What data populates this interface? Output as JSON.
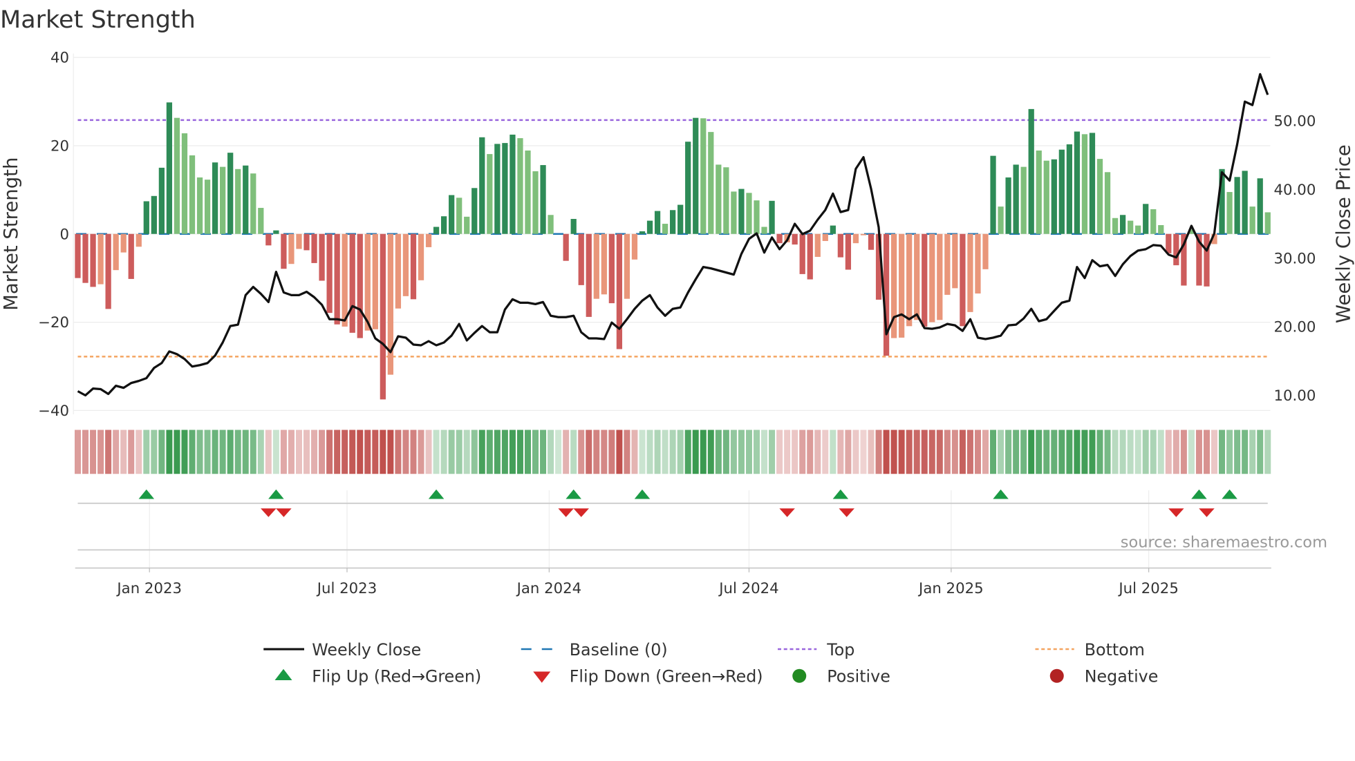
{
  "chart_data": {
    "type": "bar",
    "title": "Market Strength",
    "ylabel": "Market Strength",
    "y2label": "Weekly Close Price",
    "ylim": [
      -40,
      40
    ],
    "y2lim": [
      10,
      55
    ],
    "yticks": [
      "40",
      "20",
      "0",
      "−20",
      "−40"
    ],
    "ytick_values": [
      40,
      20,
      0,
      -20,
      -40
    ],
    "y2ticks": [
      "50.00",
      "40.00",
      "30.00",
      "20.00",
      "10.00"
    ],
    "y2tick_values": [
      50,
      40,
      30,
      20,
      10
    ],
    "xticks": [
      {
        "label": "Jan 2023",
        "week": 9.4
      },
      {
        "label": "Jul 2023",
        "week": 35.3
      },
      {
        "label": "Jan 2024",
        "week": 61.8
      },
      {
        "label": "Jul 2024",
        "week": 88.0
      },
      {
        "label": "Jan 2025",
        "week": 114.5
      },
      {
        "label": "Jul 2025",
        "week": 140.4
      }
    ],
    "top_level": 25.8,
    "bottom_level": -27.8,
    "baseline": 0,
    "strength": [
      -10.0,
      -11.1,
      -12.0,
      -11.4,
      -17.0,
      -8.2,
      -4.2,
      -10.2,
      -2.9,
      7.4,
      8.6,
      15.0,
      29.8,
      26.3,
      22.8,
      17.8,
      12.8,
      12.3,
      16.2,
      15.2,
      18.4,
      14.7,
      15.5,
      13.7,
      5.9,
      -2.6,
      0.8,
      -7.9,
      -6.8,
      -3.4,
      -3.7,
      -6.6,
      -10.6,
      -17.9,
      -20.5,
      -21.0,
      -22.4,
      -23.6,
      -21.9,
      -21.6,
      -37.5,
      -31.9,
      -16.9,
      -14.1,
      -14.8,
      -10.5,
      -3.0,
      1.6,
      4.0,
      8.8,
      8.2,
      3.9,
      10.4,
      21.9,
      18.1,
      20.4,
      20.6,
      22.5,
      21.7,
      18.9,
      14.2,
      15.6,
      4.3,
      0,
      -6.1,
      3.4,
      -11.6,
      -18.8,
      -14.7,
      -13.7,
      -15.7,
      -26.1,
      -14.7,
      -5.8,
      0.6,
      3.0,
      5.2,
      2.3,
      5.4,
      6.6,
      20.9,
      26.3,
      26.2,
      23.1,
      15.7,
      15.1,
      9.6,
      10.2,
      9.3,
      7.6,
      1.6,
      7.5,
      -2.1,
      -1.9,
      -2.4,
      -9.1,
      -10.3,
      -5.2,
      -1.6,
      1.9,
      -5.3,
      -8.1,
      -2.1,
      -0.3,
      -3.6,
      -14.9,
      -27.6,
      -23.6,
      -23.5,
      -20.9,
      -19.5,
      -21.0,
      -20.0,
      -19.5,
      -13.8,
      -12.3,
      -20.9,
      -17.7,
      -13.5,
      -8.0,
      17.7,
      6.2,
      12.8,
      15.7,
      15.2,
      28.3,
      18.9,
      16.6,
      16.9,
      19.1,
      20.3,
      23.2,
      22.6,
      22.9,
      17.0,
      14.0,
      3.6,
      4.3,
      3.0,
      1.9,
      6.8,
      5.6,
      2.0,
      -4.4,
      -7.1,
      -11.7,
      1.0,
      -11.7,
      -11.9,
      -2.3,
      14.7,
      9.5,
      12.9,
      14.3,
      6.2,
      12.6,
      4.9
    ],
    "strong": [
      1,
      1,
      1,
      0,
      1,
      0,
      0,
      1,
      0,
      1,
      1,
      1,
      1,
      0,
      0,
      0,
      0,
      0,
      1,
      0,
      1,
      0,
      1,
      0,
      0,
      1,
      1,
      1,
      0,
      0,
      1,
      1,
      1,
      1,
      1,
      0,
      1,
      1,
      0,
      0,
      1,
      0,
      0,
      0,
      1,
      0,
      0,
      1,
      1,
      1,
      0,
      0,
      1,
      1,
      0,
      1,
      1,
      1,
      0,
      0,
      0,
      1,
      0,
      0,
      1,
      1,
      1,
      1,
      0,
      0,
      1,
      1,
      0,
      0,
      1,
      1,
      1,
      0,
      1,
      1,
      1,
      1,
      0,
      0,
      0,
      0,
      0,
      1,
      0,
      0,
      0,
      1,
      1,
      0,
      1,
      1,
      1,
      0,
      0,
      1,
      1,
      1,
      0,
      0,
      1,
      1,
      1,
      0,
      0,
      0,
      0,
      1,
      0,
      0,
      0,
      0,
      1,
      0,
      0,
      0,
      1,
      0,
      1,
      1,
      0,
      1,
      0,
      0,
      1,
      1,
      1,
      1,
      0,
      1,
      0,
      0,
      0,
      1,
      0,
      0,
      1,
      0,
      0,
      1,
      1,
      1,
      0,
      1,
      1,
      0,
      1,
      0,
      1,
      1,
      0,
      1,
      0
    ],
    "weekly_close": [
      10.6,
      10.0,
      11.0,
      10.9,
      10.2,
      11.4,
      11.1,
      11.8,
      12.1,
      12.5,
      14.0,
      14.7,
      16.4,
      16.0,
      15.3,
      14.2,
      14.4,
      14.7,
      15.8,
      17.7,
      20.1,
      20.3,
      24.6,
      25.8,
      24.8,
      23.6,
      28.0,
      25.0,
      24.6,
      24.6,
      25.1,
      24.3,
      23.2,
      21.1,
      21.1,
      20.9,
      23.0,
      22.5,
      20.7,
      18.3,
      17.5,
      16.3,
      18.6,
      18.4,
      17.4,
      17.3,
      17.9,
      17.3,
      17.7,
      18.7,
      20.4,
      18.0,
      19.1,
      20.1,
      19.2,
      19.2,
      22.5,
      24.0,
      23.5,
      23.5,
      23.3,
      23.6,
      21.6,
      21.4,
      21.4,
      21.6,
      19.2,
      18.3,
      18.3,
      18.2,
      20.6,
      19.7,
      21.1,
      22.6,
      23.8,
      24.6,
      22.8,
      21.6,
      22.6,
      22.8,
      25.0,
      26.9,
      28.7,
      28.5,
      28.2,
      27.9,
      27.6,
      30.6,
      32.8,
      33.6,
      30.8,
      33.0,
      31.3,
      32.6,
      35.0,
      33.5,
      34.0,
      35.6,
      37.0,
      39.4,
      36.7,
      37.0,
      43.0,
      44.7,
      40.1,
      34.5,
      18.9,
      21.4,
      21.8,
      21.1,
      21.8,
      19.8,
      19.7,
      19.9,
      20.4,
      20.2,
      19.4,
      21.1,
      18.4,
      18.2,
      18.4,
      18.7,
      20.2,
      20.3,
      21.2,
      22.6,
      20.8,
      21.1,
      22.3,
      23.5,
      23.8,
      28.7,
      27.1,
      29.7,
      28.8,
      29.0,
      27.4,
      29.1,
      30.3,
      31.1,
      31.3,
      31.9,
      31.8,
      30.5,
      30.1,
      32.0,
      34.7,
      32.4,
      31.1,
      33.6,
      42.5,
      41.3,
      46.6,
      52.8,
      52.3,
      56.8,
      53.8
    ],
    "flip_up_weeks": [
      9,
      26,
      47,
      65,
      74,
      100,
      121,
      147,
      151
    ],
    "flip_down_weeks": [
      25,
      27,
      64,
      66,
      93,
      100.8,
      144,
      148
    ],
    "legend": {
      "weekly_close": "Weekly Close",
      "baseline": "Baseline (0)",
      "top": "Top",
      "bottom": "Bottom",
      "flip_up": "Flip Up (Red→Green)",
      "flip_down": "Flip Down (Green→Red)",
      "positive": "Positive",
      "negative": "Negative"
    },
    "legend_position": "bottom-center",
    "source": "source: sharemaestro.com"
  },
  "colors": {
    "pos_strong": "#2e8b57",
    "pos_weak": "#7fbf7b",
    "neg_strong": "#cd5c5c",
    "neg_weak": "#e9967a",
    "line": "#111111",
    "baseline": "#1f77b4",
    "top": "#9966dd",
    "bottom": "#f4a460",
    "flip_up": "#1a9a44",
    "flip_down": "#d62728",
    "positive": "#228b22",
    "negative": "#b22222"
  }
}
